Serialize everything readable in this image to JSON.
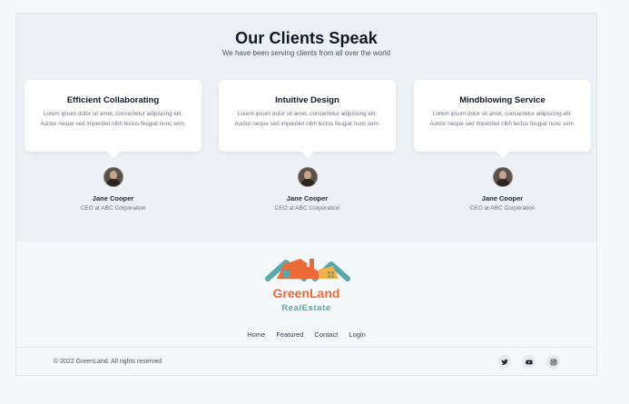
{
  "section": {
    "title": "Our Clients Speak",
    "subtitle": "We have been serving clients from all over the world"
  },
  "testimonials": [
    {
      "title": "Efficient Collaborating",
      "text": "Lorem ipsum dolor sit amet, consectetur adipiscing elit. Auctor neque sed imperdiet nibh lectus feugiat nunc sem.",
      "name": "Jane Cooper",
      "role": "CEO at ABC Corporation"
    },
    {
      "title": "Intuitive Design",
      "text": "Lorem ipsum dolor sit amet, consectetur adipiscing elit. Auctor neque sed imperdiet nibh lectus feugiat nunc sem.",
      "name": "Jane Cooper",
      "role": "CEO at ABC Corporation"
    },
    {
      "title": "Mindblowing Service",
      "text": "Lorem ipsum dolor sit amet, consectetur adipiscing elit. Auctor neque sed imperdiet nibh lectus feugiat nunc sem.",
      "name": "Jane Cooper",
      "role": "CEO at ABC Corporation"
    }
  ],
  "footer": {
    "brand_top": "GreenLand",
    "brand_bottom": "RealEstate",
    "nav": [
      "Home",
      "Featured",
      "Contact",
      "Login"
    ],
    "copyright": "© 2022 GreenLand. All rights reserved",
    "social_icons": [
      "twitter-icon",
      "youtube-icon",
      "instagram-icon"
    ]
  },
  "colors": {
    "brand_orange": "#ed6a37",
    "brand_teal": "#5aa8ad",
    "section_bg": "#edf1f5",
    "footer_bg": "#f5f8fa"
  }
}
